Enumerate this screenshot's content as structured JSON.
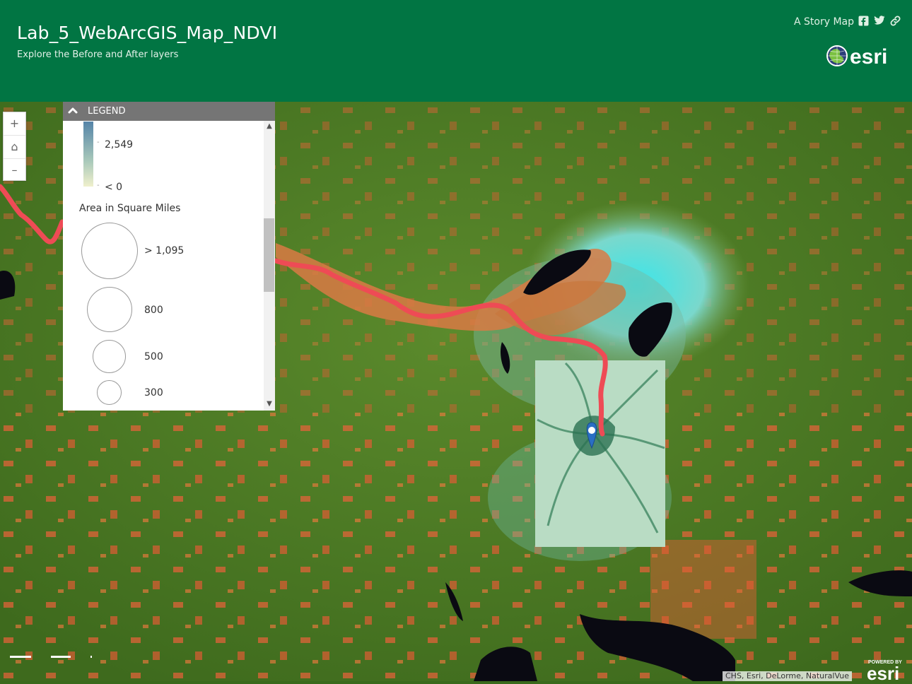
{
  "header": {
    "title": "Lab_5_WebArcGIS_Map_NDVI",
    "subtitle": "Explore the Before and After layers",
    "story_label": "A Story Map",
    "social_icons": [
      "facebook-icon",
      "twitter-icon",
      "link-icon"
    ],
    "logo_text": "esri",
    "bg_color": "#017543"
  },
  "zoom": {
    "zoom_in": "+",
    "home": "⌂",
    "zoom_out": "–"
  },
  "legend": {
    "header": "LEGEND",
    "ramp_high": "2,549",
    "ramp_low": "< 0",
    "size_title": "Area in Square Miles",
    "sizes": [
      {
        "label": "> 1,095"
      },
      {
        "label": "800"
      },
      {
        "label": "500"
      },
      {
        "label": "300"
      }
    ]
  },
  "map": {
    "attribution": "CHS, Esri, DeLorme, NaturalVue",
    "powered_by": "POWERED BY",
    "powered_logo": "esri",
    "route_color": "#ee4b55",
    "marker_color": "#2a6fc4"
  }
}
